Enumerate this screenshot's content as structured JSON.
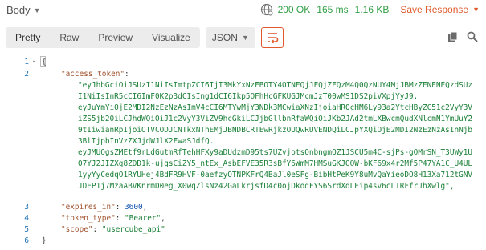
{
  "header": {
    "body_label": "Body",
    "status": "200 OK",
    "time": "165 ms",
    "size": "1.16 KB",
    "save_response": "Save Response",
    "globe_icon": "globe-icon"
  },
  "toolbar": {
    "tabs": [
      "Pretty",
      "Raw",
      "Preview",
      "Visualize"
    ],
    "active_tab": "Pretty",
    "format": "JSON",
    "wrap_icon": "wrap-lines-icon",
    "copy_icon": "copy-icon",
    "search_icon": "search-icon",
    "accent_color": "#e05a2b",
    "status_color": "#2f9e44"
  },
  "code": {
    "line_numbers": [
      "1",
      "2",
      "3",
      "4",
      "5",
      "6"
    ],
    "open_brace": "{",
    "close_brace": "}",
    "access_token_key": "\"access_token\"",
    "token_lines": [
      "\"eyJhbGciOiJSUzI1NiIsImtpZCI6IjI3MkYxNzFBOTY4OTNEQjJFQjZFQzM4Q0QzNUY4MjJBMzZENENEQzdSUz",
      "I1NiIsInR5cCI6ImF0K2p3dCIsIng1dCI6Ikp5OFhHcGFKUGJMcmJzT00wMS1DS2piVXpjYyJ9.",
      "eyJuYmYiOjE2MDI2NzEzNzAsImV4cCI6MTYwMjY3NDk3MCwiaXNzIjoiaHR0cHM6Ly93a2YtcHByZC51c2VyY3V",
      "iZS5jb20iLCJhdWQiOiJ1c2VyY3ViZV9hcGkiLCJjbGllbnRfaWQiOiJKb2JAd2tmLXBwcmQudXNlcmN1YmUuY2",
      "9tIiwianRpIjoiOTVCODJCNTkxNThEMjJBNDBCRTEwRjkzOUQwRUVENDQiLCJpYXQiOjE2MDI2NzEzNzAsInNjb",
      "3BlIjpbInVzZXJjdWJlX2FwaSJdfQ.",
      "eyJMUOgsZMEtf9rLdGutmRfTehHFXy9aDUdzmD95ts7UZvjotsOnbngmQZ1JSCU5m4C-sjPs-gOMrSN_T3UWy1U",
      "07YJ2JIZXg8ZDD1k-ujgsCiZY5_ntEx_AsbEFVE35R3sBfY6WmM7HMSuGKJOOW-bKF69x4r2Mf5P47YA1C_U4UL",
      "1yyYyCedqO1RYUHej4BdFR9HVF-0aefzyOTNPKFrQ4BaJl0eSFg-BibHtPeK9Y8uMvQaYieoDO8H13Xa712tGNV",
      "JDEP1j7MzaABVKnrmD0eg_X0wqZlsNz42GaLkrjsfD4c0ojDkodFYS6SrdXdLEip4sv6cLIRFfrJhXwlg\","
    ],
    "expires_key": "\"expires_in\"",
    "expires_value": "3600",
    "token_type_key": "\"token_type\"",
    "token_type_value": "\"Bearer\"",
    "scope_key": "\"scope\"",
    "scope_value": "\"usercube_api\""
  }
}
